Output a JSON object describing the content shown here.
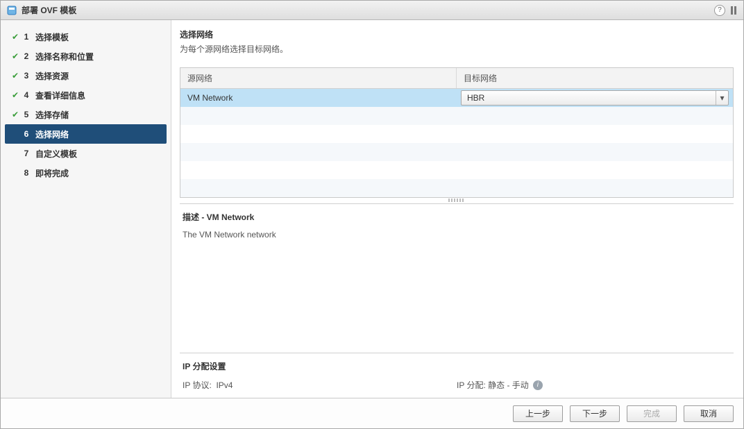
{
  "title": "部署 OVF 模板",
  "sidebar": {
    "steps": [
      {
        "num": "1",
        "label": "选择模板",
        "done": true
      },
      {
        "num": "2",
        "label": "选择名称和位置",
        "done": true
      },
      {
        "num": "3",
        "label": "选择资源",
        "done": true
      },
      {
        "num": "4",
        "label": "查看详细信息",
        "done": true
      },
      {
        "num": "5",
        "label": "选择存储",
        "done": true
      },
      {
        "num": "6",
        "label": "选择网络",
        "active": true
      },
      {
        "num": "7",
        "label": "自定义模板",
        "future": true
      },
      {
        "num": "8",
        "label": "即将完成",
        "disabled": true
      }
    ]
  },
  "main": {
    "heading": "选择网络",
    "sub": "为每个源网络选择目标网络。",
    "table": {
      "col_source": "源网络",
      "col_target": "目标网络",
      "rows": [
        {
          "source": "VM Network",
          "target": "HBR",
          "selected": true
        }
      ]
    },
    "description": {
      "title": "描述 - VM Network",
      "text": "The VM Network network"
    },
    "ip_settings": {
      "title": "IP 分配设置",
      "protocol_label": "IP 协议:",
      "protocol_value": "IPv4",
      "alloc_label": "IP 分配:",
      "alloc_value": "静态 - 手动"
    }
  },
  "footer": {
    "back": "上一步",
    "next": "下一步",
    "finish": "完成",
    "cancel": "取消"
  }
}
